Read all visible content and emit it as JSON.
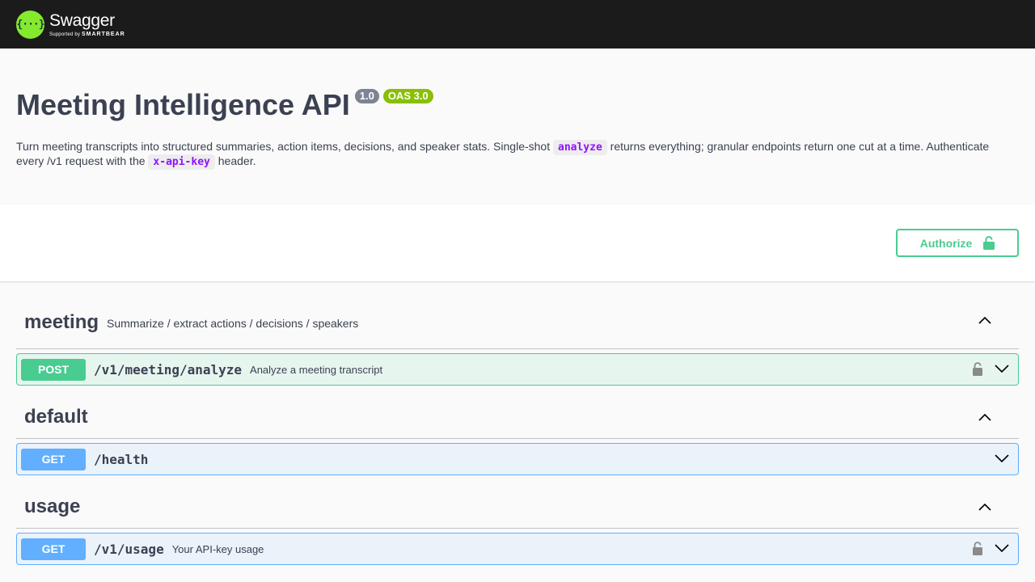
{
  "topbar": {
    "logo_glyph": "{···}",
    "logo_name": "Swagger",
    "logo_sub_prefix": "Supported by",
    "logo_sub_brand": "SMARTBEAR"
  },
  "info": {
    "title": "Meeting Intelligence API",
    "version": "1.0",
    "oas": "OAS 3.0",
    "desc_1": "Turn meeting transcripts into structured summaries, action items, decisions, and speaker stats. Single-shot ",
    "desc_code_1": "analyze",
    "desc_2": " returns everything; granular endpoints return one cut at a time. Authenticate every /v1 request with the ",
    "desc_code_2": "x-api-key",
    "desc_3": " header."
  },
  "scheme": {
    "authorize_label": "Authorize",
    "authorize_icon": "unlock-icon"
  },
  "tags": [
    {
      "name": "meeting",
      "description": "Summarize / extract actions / decisions / speakers",
      "operations": [
        {
          "method": "POST",
          "path": "/v1/meeting/analyze",
          "summary": "Analyze a meeting transcript",
          "locked": true
        }
      ]
    },
    {
      "name": "default",
      "description": "",
      "operations": [
        {
          "method": "GET",
          "path": "/health",
          "summary": "",
          "locked": false
        }
      ]
    },
    {
      "name": "usage",
      "description": "",
      "operations": [
        {
          "method": "GET",
          "path": "/v1/usage",
          "summary": "Your API-key usage",
          "locked": true
        }
      ]
    }
  ],
  "colors": {
    "post": "#49cc90",
    "get": "#61affe",
    "accent_green": "#85ea2d",
    "topbar": "#1b1b1b"
  }
}
